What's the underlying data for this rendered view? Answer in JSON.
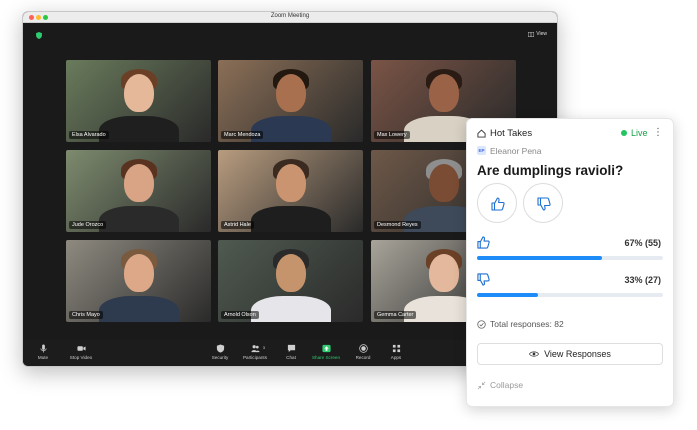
{
  "window": {
    "title": "Zoom Meeting",
    "view_label": "View"
  },
  "participants": [
    {
      "name": "Elsa Alvarado",
      "bg": "#6a7b5c",
      "skin": "#e6b89a",
      "hair": "#6b3f25",
      "shirt": "#1f1f1f"
    },
    {
      "name": "Marc Mendoza",
      "bg": "#8b6f57",
      "skin": "#a8704f",
      "hair": "#221810",
      "shirt": "#2b3a52"
    },
    {
      "name": "Max Lowery",
      "bg": "#7a5446",
      "skin": "#9a6347",
      "hair": "#2a1c14",
      "shirt": "#d9d2c4"
    },
    {
      "name": "Jude Orozco",
      "bg": "#7d8b6e",
      "skin": "#d9a486",
      "hair": "#5a3320",
      "shirt": "#2a2a2a"
    },
    {
      "name": "Astrid Hale",
      "bg": "#b89c7f",
      "skin": "#c9946f",
      "hair": "#3a2a20",
      "shirt": "#1e1e1e"
    },
    {
      "name": "Desmond Reyes",
      "bg": "#6e5848",
      "skin": "#7a4c34",
      "hair": "#8e8e8e",
      "shirt": "#3e4a5a"
    },
    {
      "name": "Chris Mayo",
      "bg": "#8e8a80",
      "skin": "#dca888",
      "hair": "#7a5a3e",
      "shirt": "#2e3a4e"
    },
    {
      "name": "Arnold Olson",
      "bg": "#4f5a50",
      "skin": "#c6946c",
      "hair": "#2a2a2a",
      "shirt": "#e6e6ea"
    },
    {
      "name": "Gemma Carter",
      "bg": "#a8a49a",
      "skin": "#e3b89c",
      "hair": "#6a4026",
      "shirt": "#e8e2da"
    }
  ],
  "toolbar": {
    "mute": "Mute",
    "stop_video": "Stop Video",
    "security": "Security",
    "participants": "Participants",
    "participants_count": "3",
    "chat": "Chat",
    "share_screen": "Share Screen",
    "record": "Record",
    "apps": "Apps"
  },
  "poll": {
    "title": "Hot Takes",
    "status": "Live",
    "author_initials": "EP",
    "author": "Eleanor Pena",
    "question": "Are dumplings ravioli?",
    "yes_label": "67% (55)",
    "yes_percent": 67,
    "no_label": "33% (27)",
    "no_percent": 33,
    "total": "Total responses: 82",
    "view_button": "View Responses",
    "collapse": "Collapse",
    "accent": "#1d8cf8",
    "live_color": "#22c55e"
  }
}
